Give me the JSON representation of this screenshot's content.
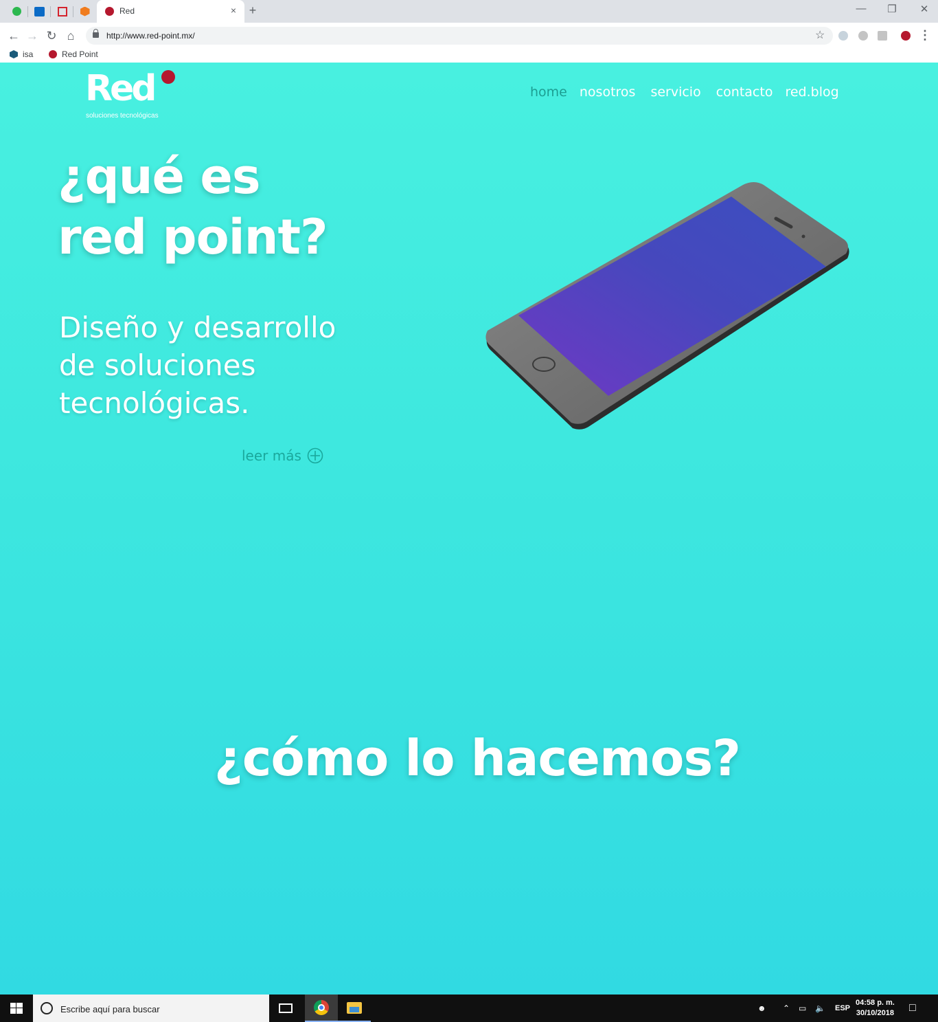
{
  "browser": {
    "active_tab_title": "Red",
    "new_tab_label": "+",
    "close_tab_label": "×",
    "url": "http://www.red-point.mx/",
    "bookmarks": [
      {
        "label": "isa"
      },
      {
        "label": "Red Point"
      }
    ]
  },
  "site": {
    "logo_text": "Red",
    "logo_tagline": "soluciones tecnológicas",
    "nav": [
      "home",
      "nosotros",
      "servicio",
      "contacto",
      "red.blog"
    ],
    "hero_title_line1": "¿qué es",
    "hero_title_line2": "red point?",
    "hero_subtitle_line1": "Diseño y desarrollo",
    "hero_subtitle_line2": "de soluciones",
    "hero_subtitle_line3": "tecnológicas.",
    "read_more_label": "leer más",
    "section_title": "¿cómo lo hacemos?"
  },
  "colors": {
    "brand_red": "#b5182e",
    "page_bg_top": "#48f0e0",
    "page_bg_bottom": "#31dae2",
    "nav_active": "#1c9e92"
  },
  "taskbar": {
    "search_placeholder": "Escribe aquí para buscar",
    "language": "ESP",
    "time": "04:58 p. m.",
    "date": "30/10/2018"
  }
}
